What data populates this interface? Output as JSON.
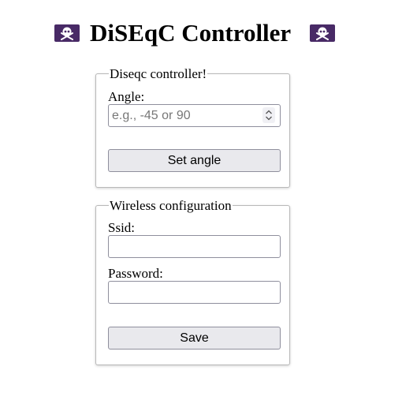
{
  "header": {
    "title": "DiSEqC Controller",
    "left_icon": "skull-crossbones-icon",
    "right_icon": "skull-crossbones-icon",
    "icon_background": "#482a66"
  },
  "diseqc_panel": {
    "legend": "Diseqc controller!",
    "angle_label": "Angle:",
    "angle_value": "",
    "angle_placeholder": "e.g., -45 or 90",
    "set_angle_button": "Set angle"
  },
  "wireless_panel": {
    "legend": "Wireless configuration",
    "ssid_label": "Ssid:",
    "ssid_value": "",
    "password_label": "Password:",
    "password_value": "",
    "save_button": "Save"
  }
}
